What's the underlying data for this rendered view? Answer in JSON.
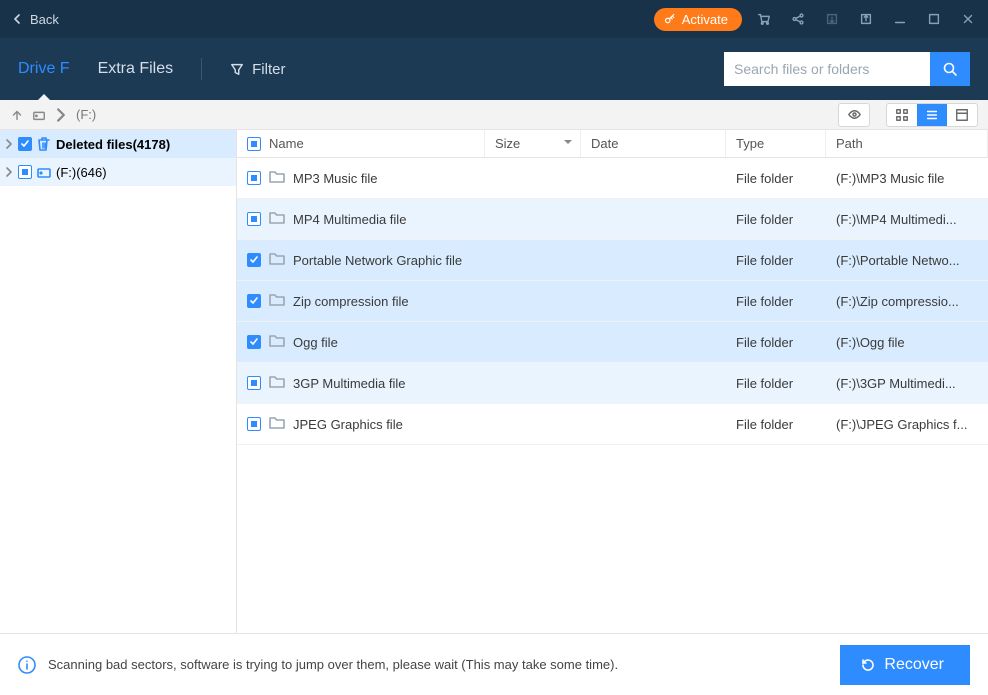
{
  "titlebar": {
    "back_label": "Back",
    "activate_label": "Activate"
  },
  "tabs": {
    "drive_label": "Drive F",
    "extra_label": "Extra Files",
    "filter_label": "Filter"
  },
  "search": {
    "placeholder": "Search files or folders"
  },
  "breadcrumb": {
    "path": "(F:)"
  },
  "sidebar": {
    "items": [
      {
        "label": "Deleted files(4178)",
        "checked": "checked",
        "icon": "trash",
        "selected": true
      },
      {
        "label": "(F:)(646)",
        "checked": "partial",
        "icon": "drive",
        "selected": false
      }
    ]
  },
  "columns": {
    "name": "Name",
    "size": "Size",
    "date": "Date",
    "type": "Type",
    "path": "Path"
  },
  "rows": [
    {
      "name": "MP3 Music file",
      "type": "File folder",
      "path": "(F:)\\MP3 Music file",
      "checked": "partial"
    },
    {
      "name": "MP4 Multimedia file",
      "type": "File folder",
      "path": "(F:)\\MP4 Multimedi...",
      "checked": "partial"
    },
    {
      "name": "Portable Network Graphic file",
      "type": "File folder",
      "path": "(F:)\\Portable Netwo...",
      "checked": "checked"
    },
    {
      "name": "Zip compression file",
      "type": "File folder",
      "path": "(F:)\\Zip compressio...",
      "checked": "checked"
    },
    {
      "name": "Ogg file",
      "type": "File folder",
      "path": "(F:)\\Ogg file",
      "checked": "checked"
    },
    {
      "name": "3GP Multimedia file",
      "type": "File folder",
      "path": "(F:)\\3GP Multimedi...",
      "checked": "partial"
    },
    {
      "name": "JPEG Graphics file",
      "type": "File folder",
      "path": "(F:)\\JPEG Graphics f...",
      "checked": "partial"
    }
  ],
  "footer": {
    "message": "Scanning bad sectors, software is trying to jump over them, please wait (This may take some time).",
    "recover_label": "Recover"
  }
}
